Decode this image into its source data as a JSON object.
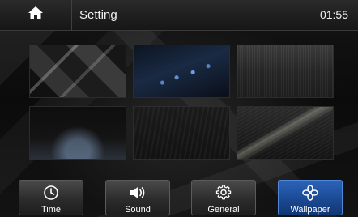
{
  "header": {
    "title": "Setting",
    "time": "01:55",
    "home_icon": "home-icon"
  },
  "wallpapers": [
    {
      "id": "wallpaper-1",
      "theme": "dark cubes"
    },
    {
      "id": "wallpaper-2",
      "theme": "blue lights"
    },
    {
      "id": "wallpaper-3",
      "theme": "brushed metal"
    },
    {
      "id": "wallpaper-4",
      "theme": "dark floor glow"
    },
    {
      "id": "wallpaper-5",
      "theme": "dark texture"
    },
    {
      "id": "wallpaper-6",
      "theme": "light streak"
    }
  ],
  "nav": {
    "time_label": "Time",
    "sound_label": "Sound",
    "general_label": "General",
    "wallpaper_label": "Wallpaper",
    "active": "Wallpaper",
    "active_color": "#2c63b8"
  }
}
